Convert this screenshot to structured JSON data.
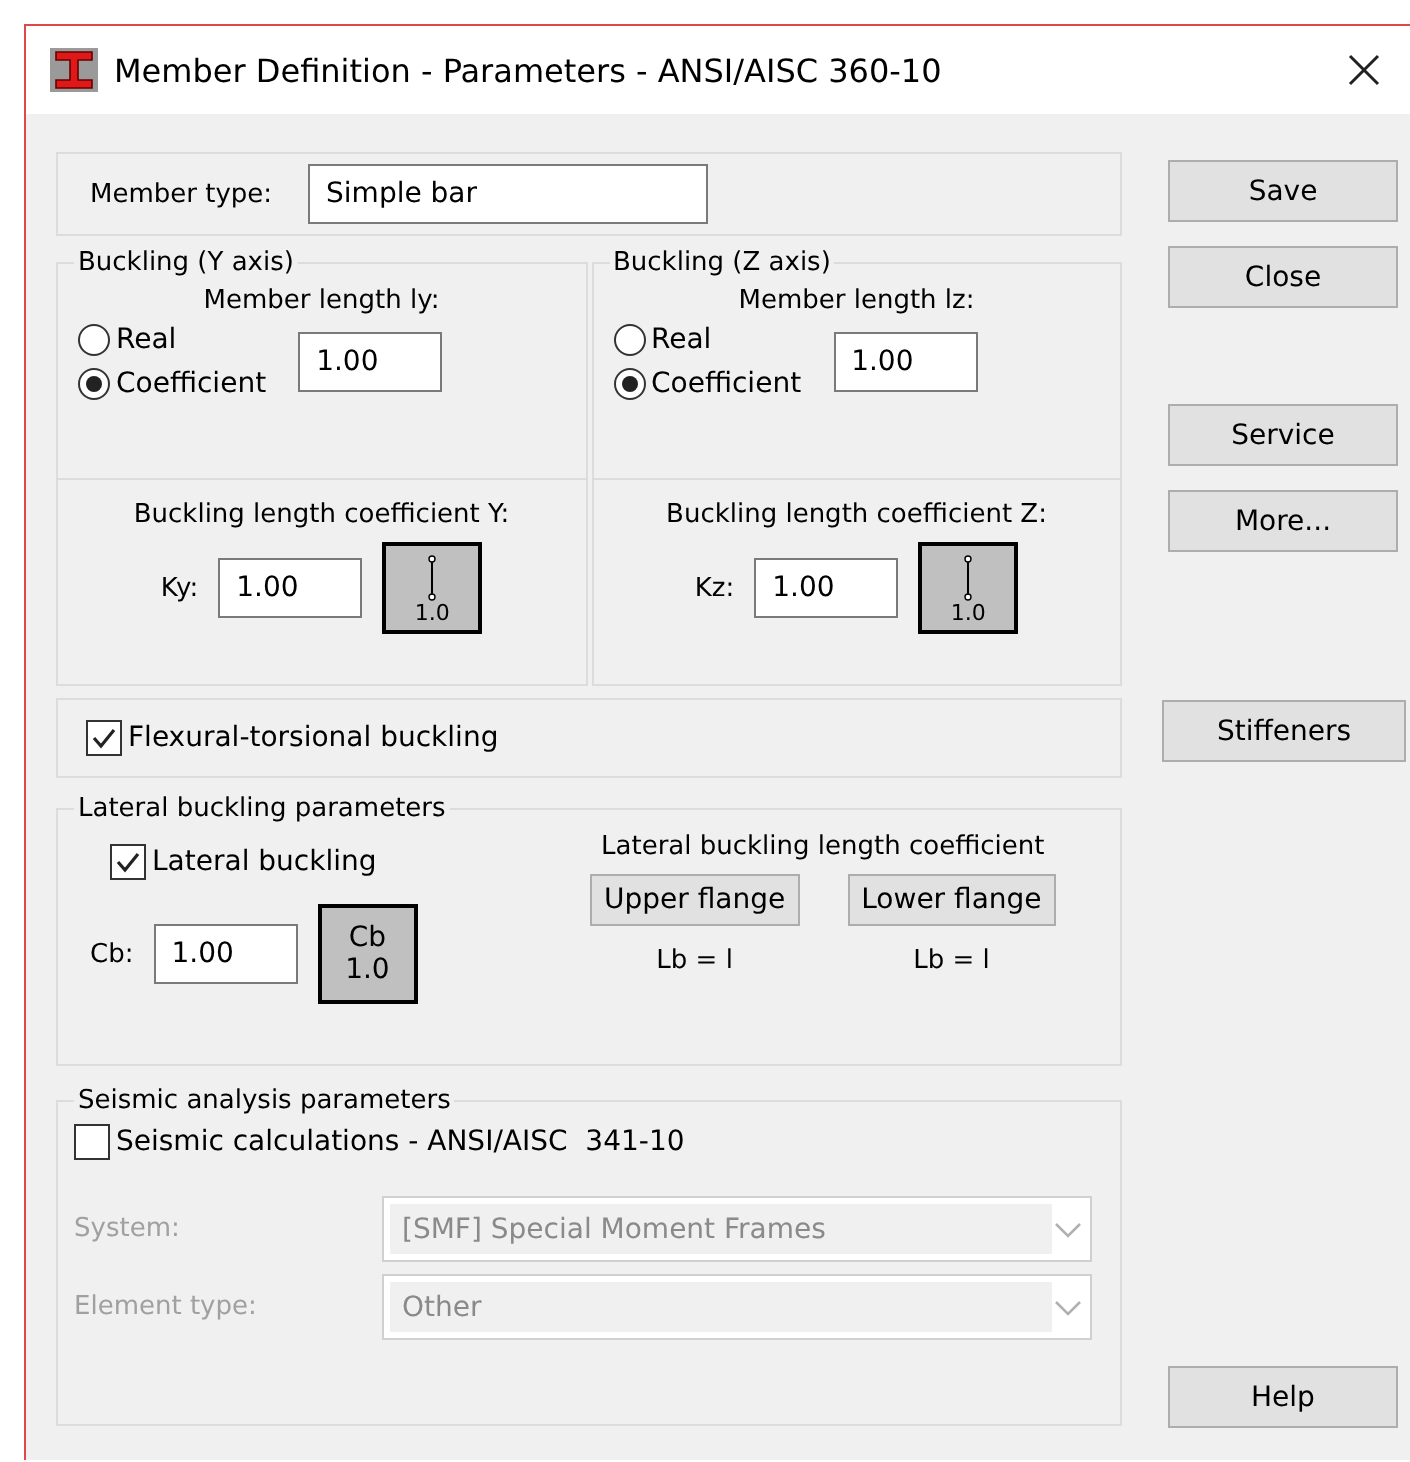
{
  "window": {
    "title": "Member Definition - Parameters - ANSI/AISC 360-10"
  },
  "member_type": {
    "label": "Member type:",
    "value": "Simple bar"
  },
  "buckling": [
    {
      "title": "Buckling (Y axis)",
      "length_label": "Member length ly:",
      "options": [
        {
          "label": "Real",
          "selected": false
        },
        {
          "label": "Coefficient",
          "selected": true
        }
      ],
      "length_value": "1.00",
      "coef_label": "Buckling length coefficient Y:",
      "k_label": "Ky:",
      "k_value": "1.00",
      "button_text": "1.0"
    },
    {
      "title": "Buckling (Z axis)",
      "length_label": "Member length lz:",
      "options": [
        {
          "label": "Real",
          "selected": false
        },
        {
          "label": "Coefficient",
          "selected": true
        }
      ],
      "length_value": "1.00",
      "coef_label": "Buckling length coefficient Z:",
      "k_label": "Kz:",
      "k_value": "1.00",
      "button_text": "1.0"
    }
  ],
  "flexural": {
    "label": "Flexural-torsional buckling",
    "checked": true
  },
  "lateral": {
    "title": "Lateral buckling parameters",
    "checkbox": {
      "label": "Lateral buckling",
      "checked": true
    },
    "cb_label": "Cb:",
    "cb_value": "1.00",
    "cb_button": "Cb\n1.0",
    "coef_title": "Lateral buckling length coefficient",
    "flanges": [
      {
        "button": "Upper flange",
        "reading": "Lb = l"
      },
      {
        "button": "Lower flange",
        "reading": "Lb = l"
      }
    ]
  },
  "seismic": {
    "title": "Seismic analysis parameters",
    "checkbox": {
      "label": "Seismic calculations - ANSI/AISC  341-10",
      "checked": false
    },
    "fields": [
      {
        "label": "System:",
        "value": "[SMF] Special Moment Frames",
        "disabled": true
      },
      {
        "label": "Element type:",
        "value": "Other",
        "disabled": true
      }
    ]
  },
  "side_buttons": [
    [
      "Save",
      "Close"
    ],
    [
      "Service",
      "More..."
    ],
    [
      "Stiffeners"
    ],
    [
      "Help"
    ]
  ]
}
